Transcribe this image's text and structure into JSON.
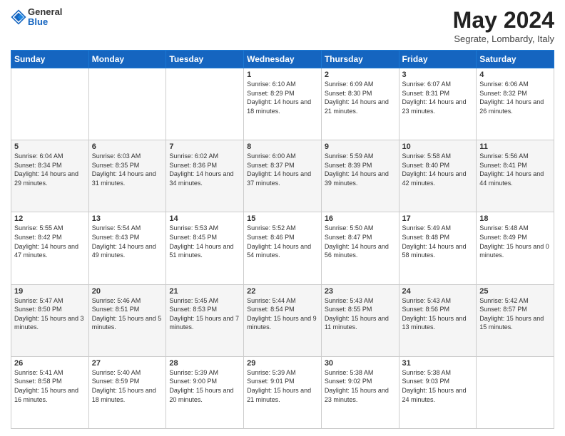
{
  "header": {
    "logo_general": "General",
    "logo_blue": "Blue",
    "month_title": "May 2024",
    "location": "Segrate, Lombardy, Italy"
  },
  "weekdays": [
    "Sunday",
    "Monday",
    "Tuesday",
    "Wednesday",
    "Thursday",
    "Friday",
    "Saturday"
  ],
  "weeks": [
    [
      {
        "day": "",
        "sunrise": "",
        "sunset": "",
        "daylight": ""
      },
      {
        "day": "",
        "sunrise": "",
        "sunset": "",
        "daylight": ""
      },
      {
        "day": "",
        "sunrise": "",
        "sunset": "",
        "daylight": ""
      },
      {
        "day": "1",
        "sunrise": "Sunrise: 6:10 AM",
        "sunset": "Sunset: 8:29 PM",
        "daylight": "Daylight: 14 hours and 18 minutes."
      },
      {
        "day": "2",
        "sunrise": "Sunrise: 6:09 AM",
        "sunset": "Sunset: 8:30 PM",
        "daylight": "Daylight: 14 hours and 21 minutes."
      },
      {
        "day": "3",
        "sunrise": "Sunrise: 6:07 AM",
        "sunset": "Sunset: 8:31 PM",
        "daylight": "Daylight: 14 hours and 23 minutes."
      },
      {
        "day": "4",
        "sunrise": "Sunrise: 6:06 AM",
        "sunset": "Sunset: 8:32 PM",
        "daylight": "Daylight: 14 hours and 26 minutes."
      }
    ],
    [
      {
        "day": "5",
        "sunrise": "Sunrise: 6:04 AM",
        "sunset": "Sunset: 8:34 PM",
        "daylight": "Daylight: 14 hours and 29 minutes."
      },
      {
        "day": "6",
        "sunrise": "Sunrise: 6:03 AM",
        "sunset": "Sunset: 8:35 PM",
        "daylight": "Daylight: 14 hours and 31 minutes."
      },
      {
        "day": "7",
        "sunrise": "Sunrise: 6:02 AM",
        "sunset": "Sunset: 8:36 PM",
        "daylight": "Daylight: 14 hours and 34 minutes."
      },
      {
        "day": "8",
        "sunrise": "Sunrise: 6:00 AM",
        "sunset": "Sunset: 8:37 PM",
        "daylight": "Daylight: 14 hours and 37 minutes."
      },
      {
        "day": "9",
        "sunrise": "Sunrise: 5:59 AM",
        "sunset": "Sunset: 8:39 PM",
        "daylight": "Daylight: 14 hours and 39 minutes."
      },
      {
        "day": "10",
        "sunrise": "Sunrise: 5:58 AM",
        "sunset": "Sunset: 8:40 PM",
        "daylight": "Daylight: 14 hours and 42 minutes."
      },
      {
        "day": "11",
        "sunrise": "Sunrise: 5:56 AM",
        "sunset": "Sunset: 8:41 PM",
        "daylight": "Daylight: 14 hours and 44 minutes."
      }
    ],
    [
      {
        "day": "12",
        "sunrise": "Sunrise: 5:55 AM",
        "sunset": "Sunset: 8:42 PM",
        "daylight": "Daylight: 14 hours and 47 minutes."
      },
      {
        "day": "13",
        "sunrise": "Sunrise: 5:54 AM",
        "sunset": "Sunset: 8:43 PM",
        "daylight": "Daylight: 14 hours and 49 minutes."
      },
      {
        "day": "14",
        "sunrise": "Sunrise: 5:53 AM",
        "sunset": "Sunset: 8:45 PM",
        "daylight": "Daylight: 14 hours and 51 minutes."
      },
      {
        "day": "15",
        "sunrise": "Sunrise: 5:52 AM",
        "sunset": "Sunset: 8:46 PM",
        "daylight": "Daylight: 14 hours and 54 minutes."
      },
      {
        "day": "16",
        "sunrise": "Sunrise: 5:50 AM",
        "sunset": "Sunset: 8:47 PM",
        "daylight": "Daylight: 14 hours and 56 minutes."
      },
      {
        "day": "17",
        "sunrise": "Sunrise: 5:49 AM",
        "sunset": "Sunset: 8:48 PM",
        "daylight": "Daylight: 14 hours and 58 minutes."
      },
      {
        "day": "18",
        "sunrise": "Sunrise: 5:48 AM",
        "sunset": "Sunset: 8:49 PM",
        "daylight": "Daylight: 15 hours and 0 minutes."
      }
    ],
    [
      {
        "day": "19",
        "sunrise": "Sunrise: 5:47 AM",
        "sunset": "Sunset: 8:50 PM",
        "daylight": "Daylight: 15 hours and 3 minutes."
      },
      {
        "day": "20",
        "sunrise": "Sunrise: 5:46 AM",
        "sunset": "Sunset: 8:51 PM",
        "daylight": "Daylight: 15 hours and 5 minutes."
      },
      {
        "day": "21",
        "sunrise": "Sunrise: 5:45 AM",
        "sunset": "Sunset: 8:53 PM",
        "daylight": "Daylight: 15 hours and 7 minutes."
      },
      {
        "day": "22",
        "sunrise": "Sunrise: 5:44 AM",
        "sunset": "Sunset: 8:54 PM",
        "daylight": "Daylight: 15 hours and 9 minutes."
      },
      {
        "day": "23",
        "sunrise": "Sunrise: 5:43 AM",
        "sunset": "Sunset: 8:55 PM",
        "daylight": "Daylight: 15 hours and 11 minutes."
      },
      {
        "day": "24",
        "sunrise": "Sunrise: 5:43 AM",
        "sunset": "Sunset: 8:56 PM",
        "daylight": "Daylight: 15 hours and 13 minutes."
      },
      {
        "day": "25",
        "sunrise": "Sunrise: 5:42 AM",
        "sunset": "Sunset: 8:57 PM",
        "daylight": "Daylight: 15 hours and 15 minutes."
      }
    ],
    [
      {
        "day": "26",
        "sunrise": "Sunrise: 5:41 AM",
        "sunset": "Sunset: 8:58 PM",
        "daylight": "Daylight: 15 hours and 16 minutes."
      },
      {
        "day": "27",
        "sunrise": "Sunrise: 5:40 AM",
        "sunset": "Sunset: 8:59 PM",
        "daylight": "Daylight: 15 hours and 18 minutes."
      },
      {
        "day": "28",
        "sunrise": "Sunrise: 5:39 AM",
        "sunset": "Sunset: 9:00 PM",
        "daylight": "Daylight: 15 hours and 20 minutes."
      },
      {
        "day": "29",
        "sunrise": "Sunrise: 5:39 AM",
        "sunset": "Sunset: 9:01 PM",
        "daylight": "Daylight: 15 hours and 21 minutes."
      },
      {
        "day": "30",
        "sunrise": "Sunrise: 5:38 AM",
        "sunset": "Sunset: 9:02 PM",
        "daylight": "Daylight: 15 hours and 23 minutes."
      },
      {
        "day": "31",
        "sunrise": "Sunrise: 5:38 AM",
        "sunset": "Sunset: 9:03 PM",
        "daylight": "Daylight: 15 hours and 24 minutes."
      },
      {
        "day": "",
        "sunrise": "",
        "sunset": "",
        "daylight": ""
      }
    ]
  ]
}
